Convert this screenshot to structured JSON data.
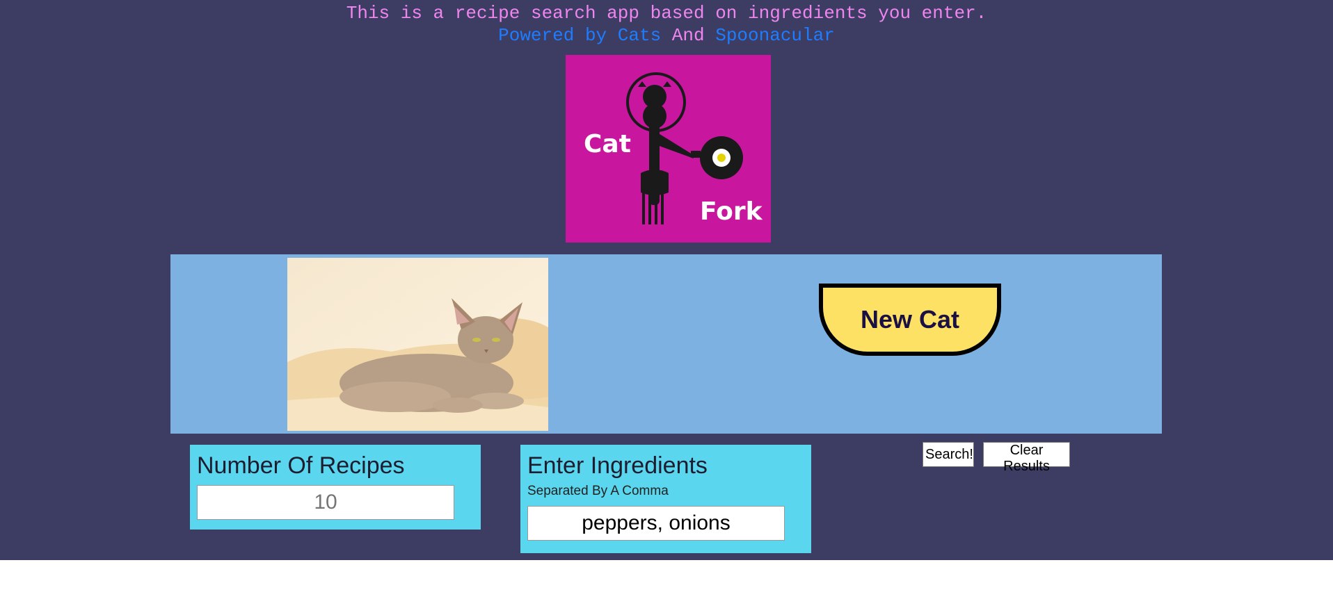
{
  "header": {
    "tagline": "This is a recipe search app based on ingredients you enter.",
    "powered_prefix": "Powered by",
    "cats_link": "Cats",
    "and_text": "And",
    "spoonacular_link": "Spoonacular"
  },
  "logo": {
    "word_cat": "Cat",
    "word_fork": "Fork",
    "background": "#c8169e"
  },
  "cat_section": {
    "new_cat_label": "New Cat"
  },
  "recipes_panel": {
    "title": "Number Of Recipes",
    "placeholder": "10"
  },
  "ingredients_panel": {
    "title": "Enter Ingredients",
    "subtitle": "Separated By A Comma",
    "placeholder": "peppers, onions"
  },
  "actions": {
    "search_label": "Search!",
    "clear_label": "Clear Results"
  },
  "colors": {
    "page_bg": "#3d3d63",
    "tagline": "#ef85ef",
    "link": "#1e7cff",
    "band": "#7cb1e1",
    "panel": "#5ad6ee",
    "button": "#fde165"
  }
}
